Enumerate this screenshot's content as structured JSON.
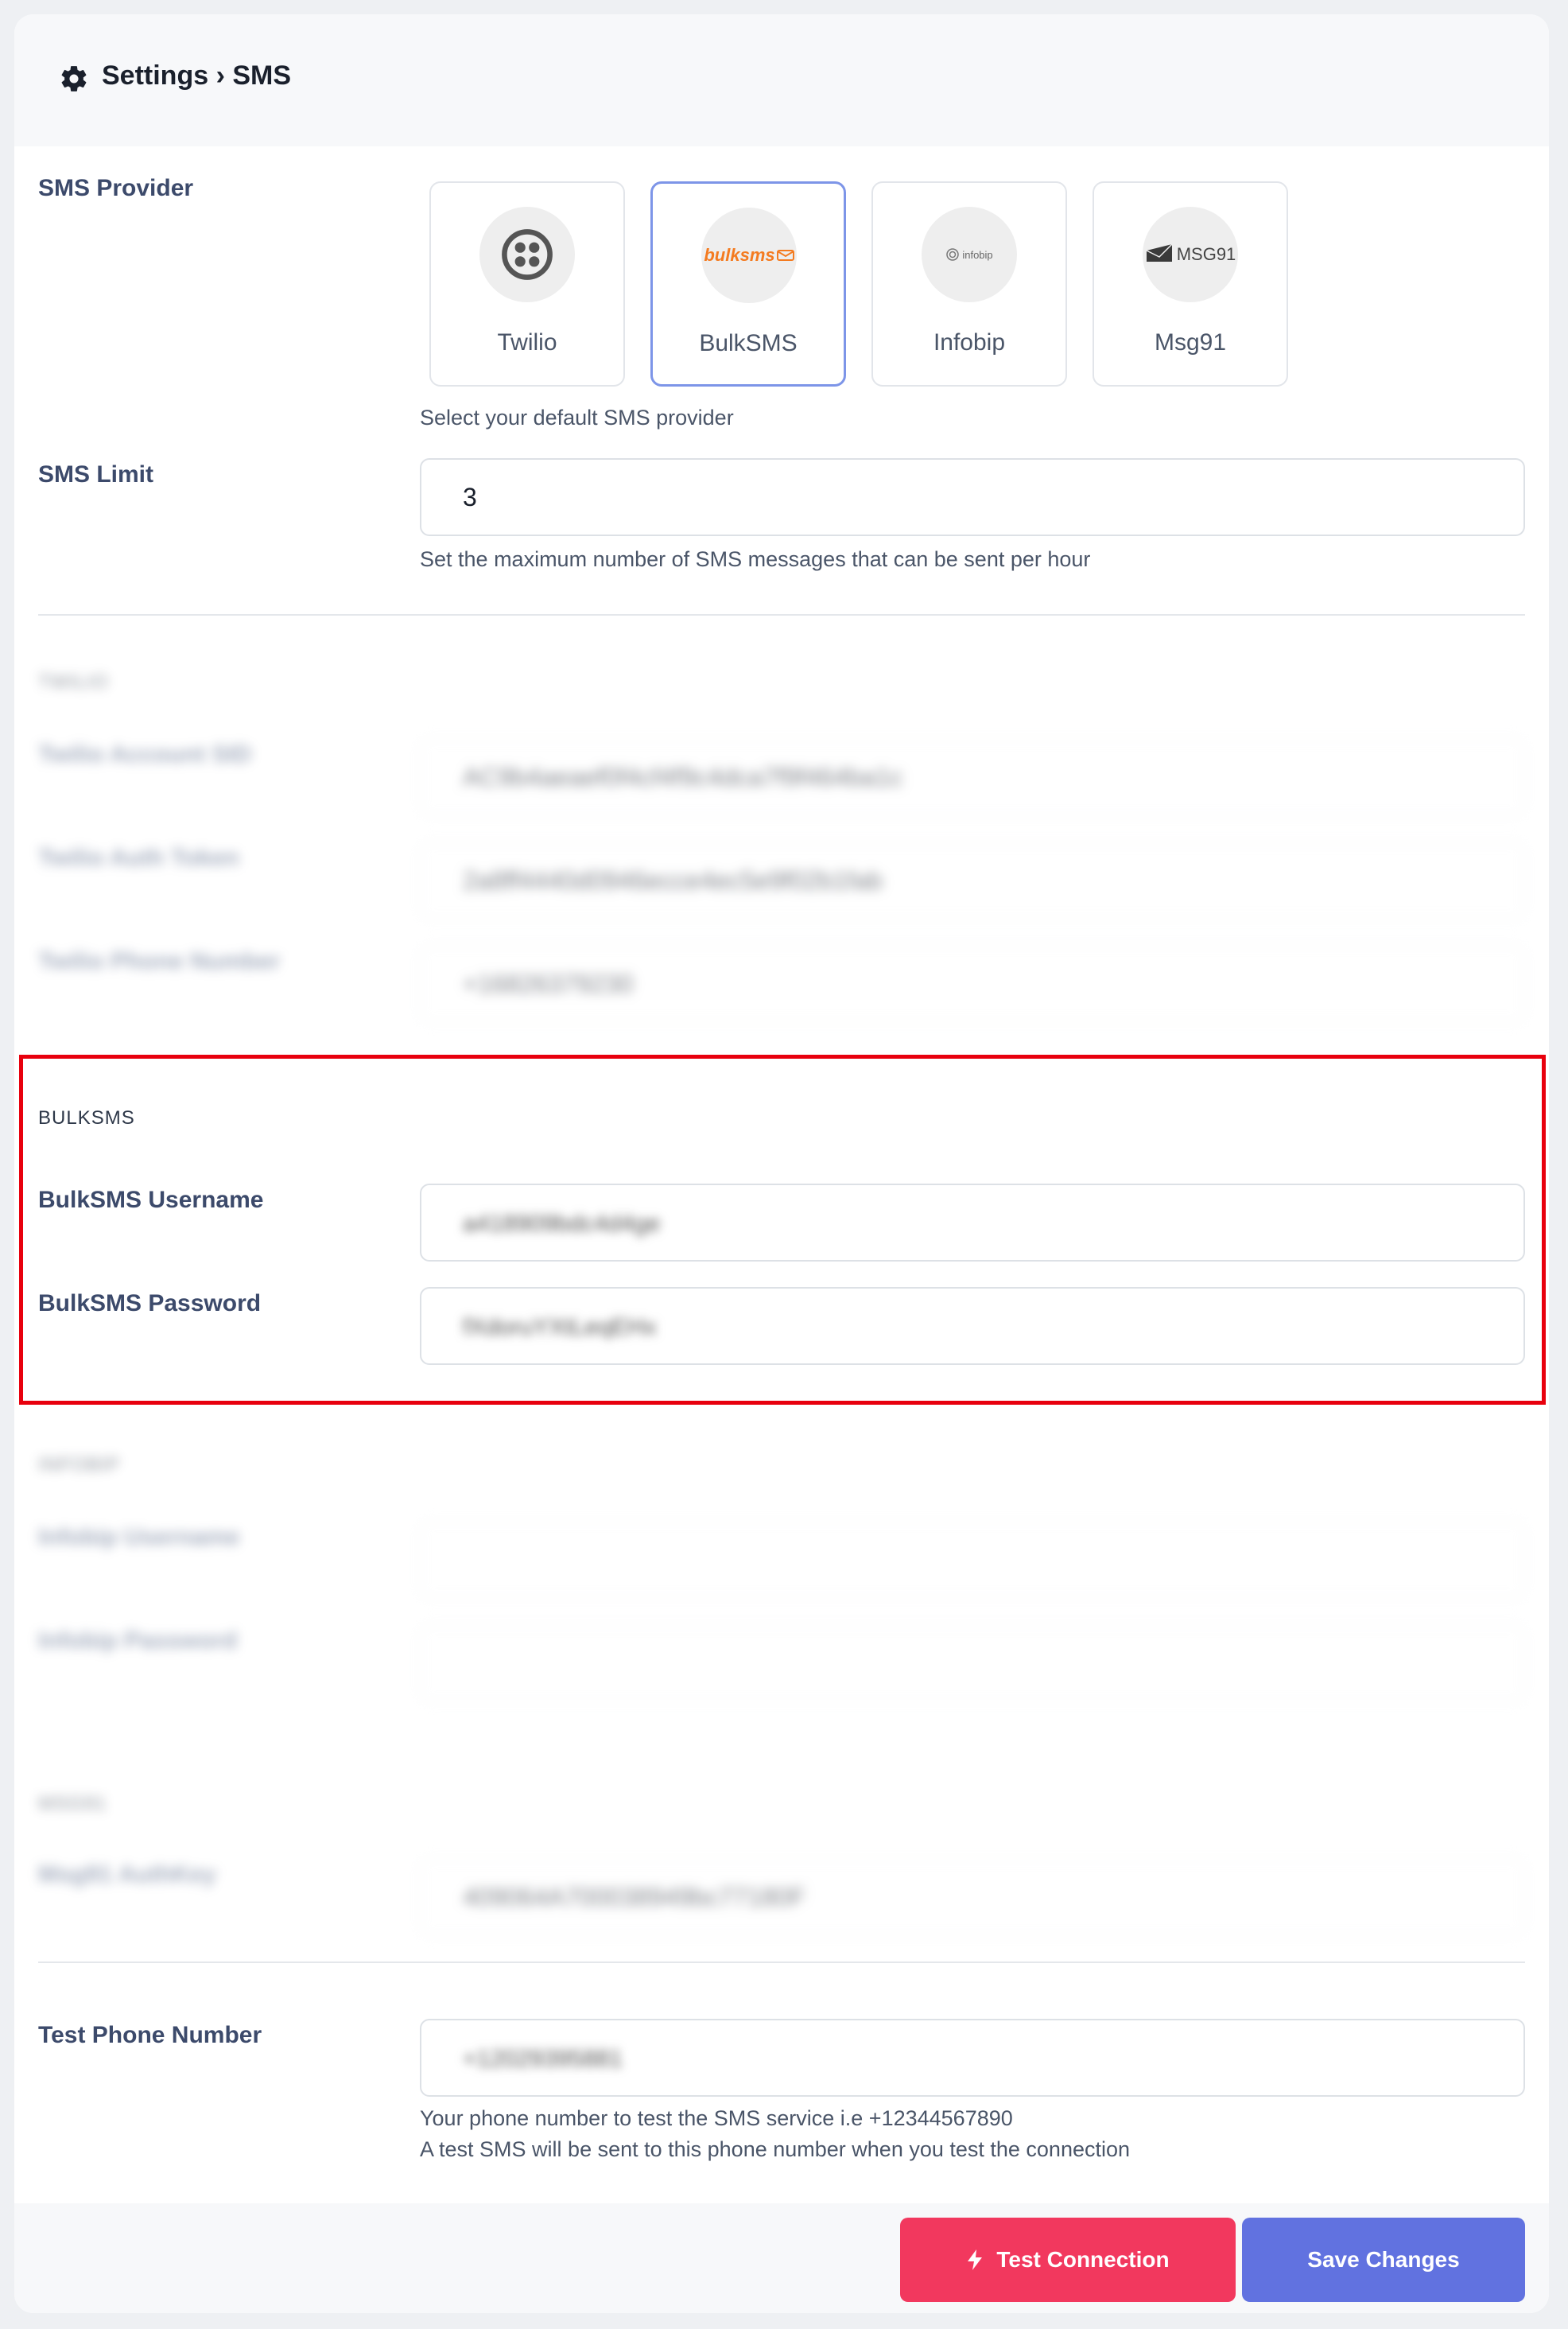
{
  "header": {
    "title": "Settings › SMS"
  },
  "provider": {
    "label": "SMS Provider",
    "help": "Select your default SMS provider",
    "options": [
      {
        "name": "Twilio",
        "icon": "twilio-logo-icon",
        "selected": false
      },
      {
        "name": "BulkSMS",
        "icon": "bulksms-logo-icon",
        "selected": true,
        "logo_text": "bulksms"
      },
      {
        "name": "Infobip",
        "icon": "infobip-logo-icon",
        "selected": false,
        "logo_text": "infobip"
      },
      {
        "name": "Msg91",
        "icon": "msg91-logo-icon",
        "selected": false,
        "logo_text": "MSG91"
      }
    ]
  },
  "limit": {
    "label": "SMS Limit",
    "value": "3",
    "help": "Set the maximum number of SMS messages that can be sent per hour"
  },
  "twilio": {
    "section": "TWILIO",
    "account_sid_label": "Twilio Account SID",
    "account_sid_value": "AC9b4aeaef0f4cf4f9c4dca7f9f464ba1c",
    "auth_token_label": "Twilio Auth Token",
    "auth_token_value": "2a8ff4440d0946ecce4ec5e9f02b1fab",
    "phone_label": "Twilio Phone Number",
    "phone_value": "+16826379230"
  },
  "bulksms": {
    "section": "BULKSMS",
    "username_label": "BulkSMS Username",
    "username_value": "a418909bdc4d4ge",
    "password_label": "BulkSMS Password",
    "password_value": "fXdoruYXtLeqEHx"
  },
  "infobip": {
    "section": "INFOBIP",
    "username_label": "Infobip Username",
    "password_label": "Infobip Password"
  },
  "msg91": {
    "section": "MSG91",
    "authkey_label": "Msg91 AuthKey",
    "authkey_value": "409064A700038949bc77180F"
  },
  "test_phone": {
    "label": "Test Phone Number",
    "value": "+12029395881",
    "help_line1": "Your phone number to test the SMS service i.e +12344567890",
    "help_line2": "A test SMS will be sent to this phone number when you test the connection"
  },
  "actions": {
    "test_label": "Test Connection",
    "save_label": "Save Changes"
  },
  "colors": {
    "test_button": "#f2385e",
    "save_button": "#6172e0",
    "selected_border": "#7d95e8",
    "highlight_box": "#e8000d"
  }
}
